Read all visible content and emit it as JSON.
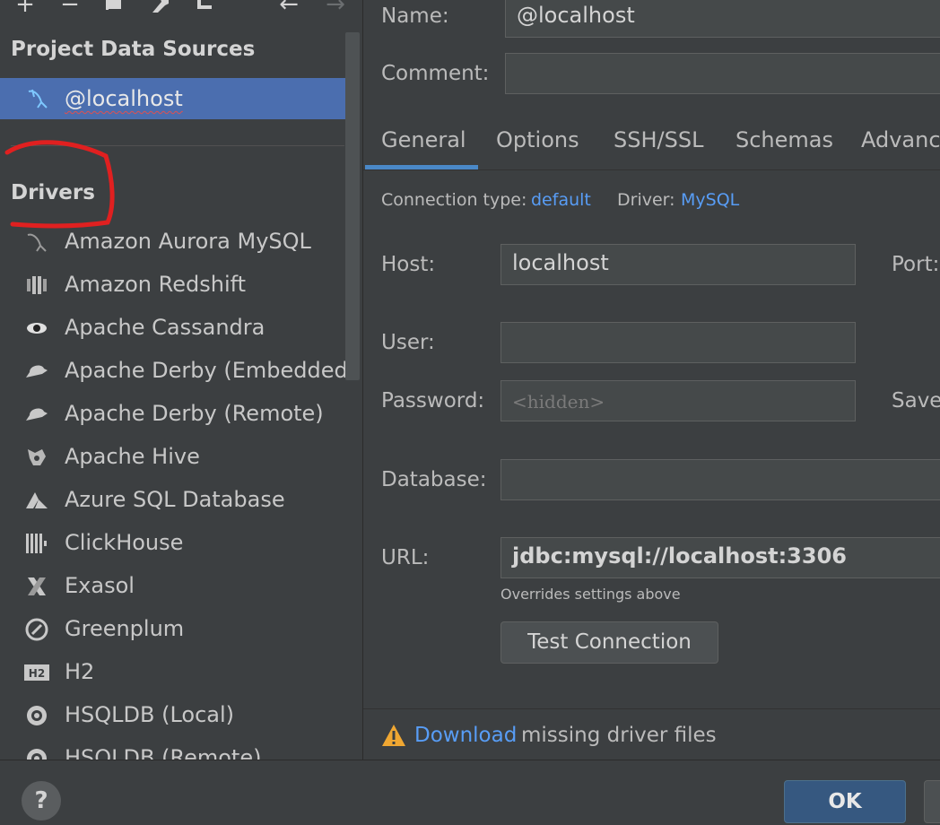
{
  "toolbar": {
    "icons": [
      "add-icon",
      "remove-icon",
      "duplicate-icon",
      "wrench-icon",
      "import-icon",
      "back-icon",
      "forward-icon"
    ]
  },
  "left": {
    "project_title": "Project Data Sources",
    "datasource": "@localhost",
    "drivers_title": "Drivers",
    "drivers": [
      {
        "label": "Amazon Aurora MySQL",
        "icon": "dolphin-icon"
      },
      {
        "label": "Amazon Redshift",
        "icon": "redshift-icon"
      },
      {
        "label": "Apache Cassandra",
        "icon": "eye-icon"
      },
      {
        "label": "Apache Derby (Embedded)",
        "icon": "hat-icon"
      },
      {
        "label": "Apache Derby (Remote)",
        "icon": "hat-icon"
      },
      {
        "label": "Apache Hive",
        "icon": "bee-icon"
      },
      {
        "label": "Azure SQL Database",
        "icon": "azure-icon"
      },
      {
        "label": "ClickHouse",
        "icon": "bars-icon"
      },
      {
        "label": "Exasol",
        "icon": "x-icon"
      },
      {
        "label": "Greenplum",
        "icon": "greenplum-icon"
      },
      {
        "label": "H2",
        "icon": "h2-icon"
      },
      {
        "label": "HSQLDB (Local)",
        "icon": "hsqldb-icon"
      },
      {
        "label": "HSQLDB (Remote)",
        "icon": "hsqldb-icon"
      }
    ],
    "annotation_color": "#e02020"
  },
  "form": {
    "name_label": "Name:",
    "name_value": "@localhost",
    "comment_label": "Comment:",
    "comment_value": "",
    "tabs": [
      "General",
      "Options",
      "SSH/SSL",
      "Schemas",
      "Advanced"
    ],
    "active_tab": "General",
    "conn_type_label": "Connection type:",
    "conn_type_value": "default",
    "driver_label": "Driver:",
    "driver_value": "MySQL",
    "host_label": "Host:",
    "host_value": "localhost",
    "port_label": "Port:",
    "user_label": "User:",
    "user_value": "",
    "password_label": "Password:",
    "password_placeholder": "<hidden>",
    "save_label": "Save",
    "database_label": "Database:",
    "database_value": "",
    "url_label": "URL:",
    "url_value": "jdbc:mysql://localhost:3306",
    "url_hint": "Overrides settings above",
    "test_button": "Test Connection",
    "warn_link": "Download",
    "warn_text": " missing driver files"
  },
  "bottom": {
    "help": "?",
    "ok": "OK"
  },
  "colors": {
    "selection": "#4b6eaf",
    "link": "#589df6",
    "tab_underline": "#4a88c7",
    "ok_button": "#365880",
    "warning": "#f0a732"
  }
}
